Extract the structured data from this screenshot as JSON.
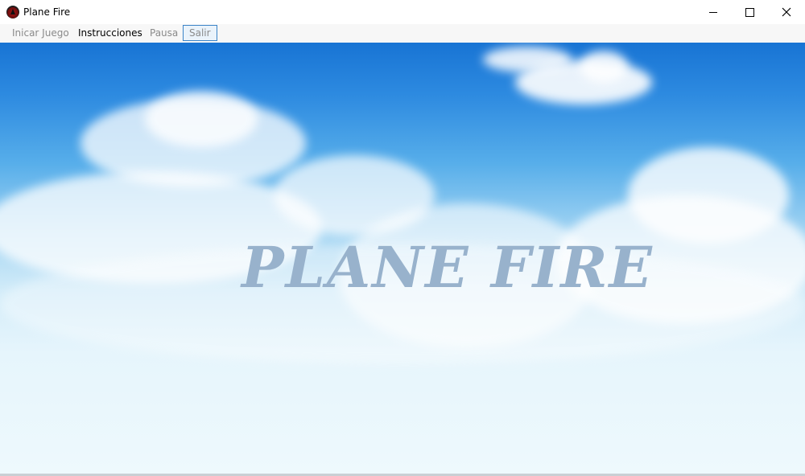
{
  "window": {
    "title": "Plane Fire",
    "icon": "app-icon"
  },
  "menu": {
    "items": [
      {
        "label": "Inicar Juego"
      },
      {
        "label": "Instrucciones"
      },
      {
        "label": "Pausa"
      },
      {
        "label": "Salir"
      }
    ]
  },
  "game": {
    "title": "PLANE FIRE",
    "title_color": "#98b2cc",
    "sky_top_color": "#1874d4",
    "sky_bottom_color": "#eef9fd"
  }
}
